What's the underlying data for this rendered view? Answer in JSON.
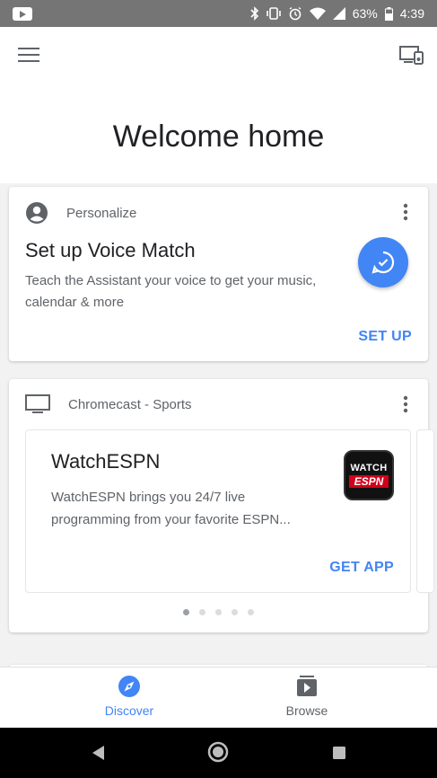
{
  "status_bar": {
    "battery": "63%",
    "time": "4:39"
  },
  "header": {
    "welcome": "Welcome home"
  },
  "cards": [
    {
      "category": "Personalize",
      "title": "Set up Voice Match",
      "description": "Teach the Assistant your voice to get your music, calendar & more",
      "action": "SET UP"
    },
    {
      "category": "Chromecast - Sports",
      "item_title": "WatchESPN",
      "item_description_line1": "WatchESPN brings you 24/7 live",
      "item_description_line2": "programming from your favorite ESPN...",
      "logo_top": "WATCH",
      "logo_bottom": "ESPN",
      "action": "GET APP",
      "pagination": {
        "total": 5,
        "active": 1
      }
    }
  ],
  "bottom_nav": {
    "items": [
      {
        "label": "Discover",
        "active": true
      },
      {
        "label": "Browse",
        "active": false
      }
    ]
  },
  "colors": {
    "accent": "#4285f4",
    "espn_red": "#d0021b"
  },
  "icons": [
    "menu-icon",
    "cast-device-icon",
    "account-icon",
    "tv-icon",
    "more-vert-icon",
    "voice-match-icon",
    "compass-icon",
    "browse-icon",
    "back-icon",
    "home-icon",
    "recents-icon"
  ]
}
